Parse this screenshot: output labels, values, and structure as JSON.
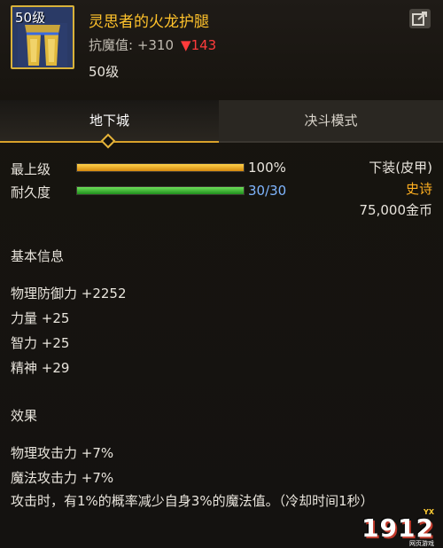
{
  "item": {
    "level_badge": "50级",
    "name": "灵思者的火龙护腿",
    "stat_label": "抗魔值: +310",
    "stat_change": "▼143",
    "level": "50级"
  },
  "tabs": [
    {
      "label": "地下城",
      "active": true
    },
    {
      "label": "决斗模式",
      "active": false
    }
  ],
  "durability": {
    "top_label": "最上级",
    "top_value": "100%",
    "top_percent": 100,
    "durability_label": "耐久度",
    "durability_value": "30/30",
    "durability_fraction": 1.0
  },
  "info_right": {
    "slot": "下装(皮甲)",
    "rarity": "史诗",
    "price": "75,000金币"
  },
  "basic_info": {
    "title": "基本信息",
    "lines": [
      "物理防御力 +2252",
      "力量 +25",
      "智力 +25",
      "精神 +29"
    ]
  },
  "effects": {
    "title": "效果",
    "lines": [
      "物理攻击力 +7%",
      "魔法攻击力 +7%"
    ],
    "description": "攻击时，有1%的概率减少自身3%的魔法值。（冷却时间1秒）"
  },
  "watermark": {
    "text": "1912",
    "sub": "YX",
    "sub2": "网页游戏"
  },
  "colors": {
    "item_name": "#ffc22b",
    "rarity": "#ffb020",
    "down": "#ff3b3b",
    "durability_text": "#7fb6ff",
    "tab_accent": "#d8a12a"
  }
}
